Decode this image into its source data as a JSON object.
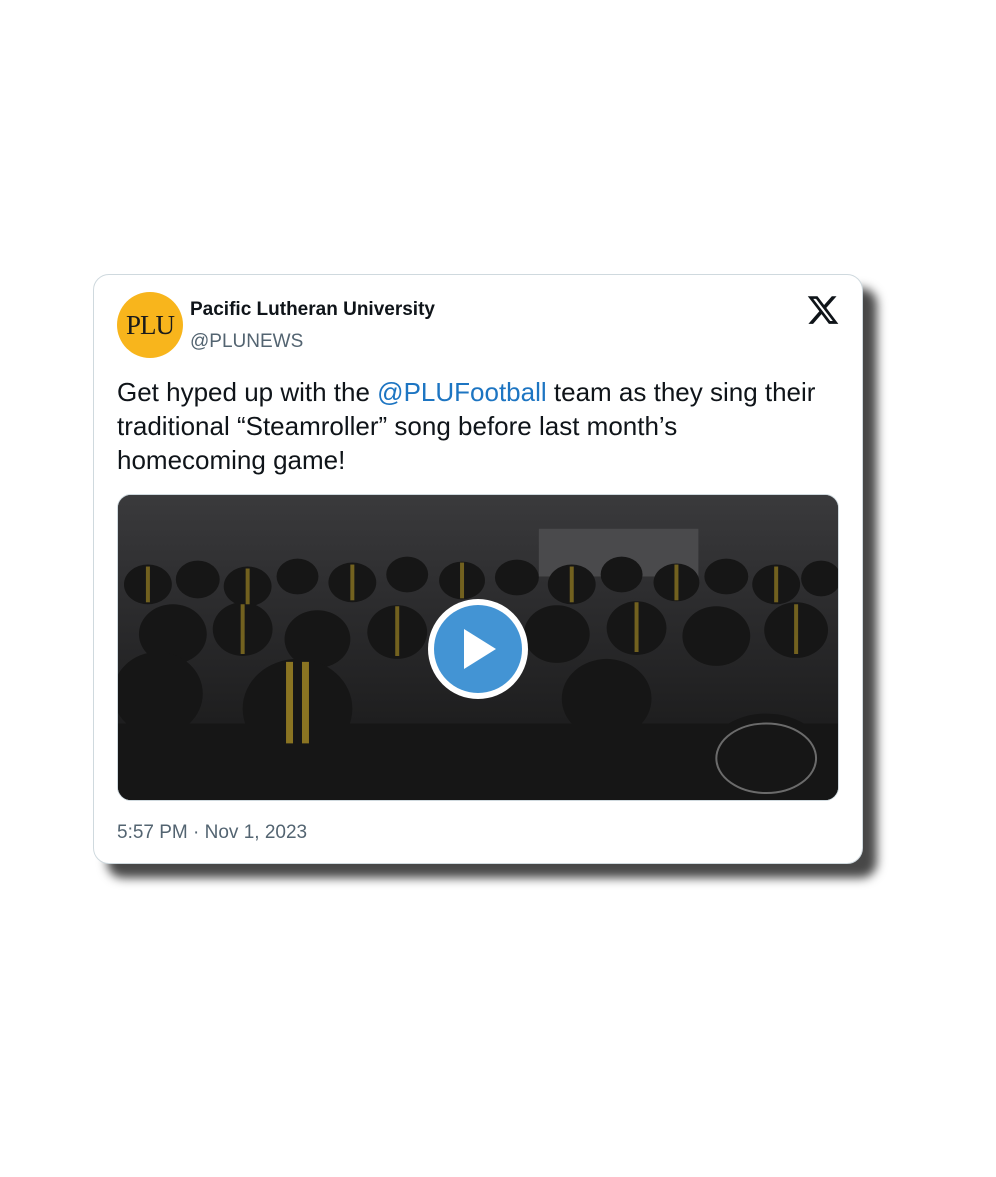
{
  "tweet": {
    "author_name": "Pacific Lutheran University",
    "author_handle": "@PLUNEWS",
    "avatar_text": "PLU",
    "text_before": "Get hyped up with the ",
    "mention": "@PLUFootball",
    "text_after": " team as they sing their traditional “Steamroller” song before last month’s homecoming game!",
    "timestamp": "5:57 PM · Nov 1, 2023"
  },
  "icons": {
    "platform": "x-logo-icon",
    "play": "play-icon"
  },
  "colors": {
    "avatar_bg": "#f8b51c",
    "mention": "#1d75c2",
    "play_button": "#4394d4",
    "handle": "#536471"
  }
}
